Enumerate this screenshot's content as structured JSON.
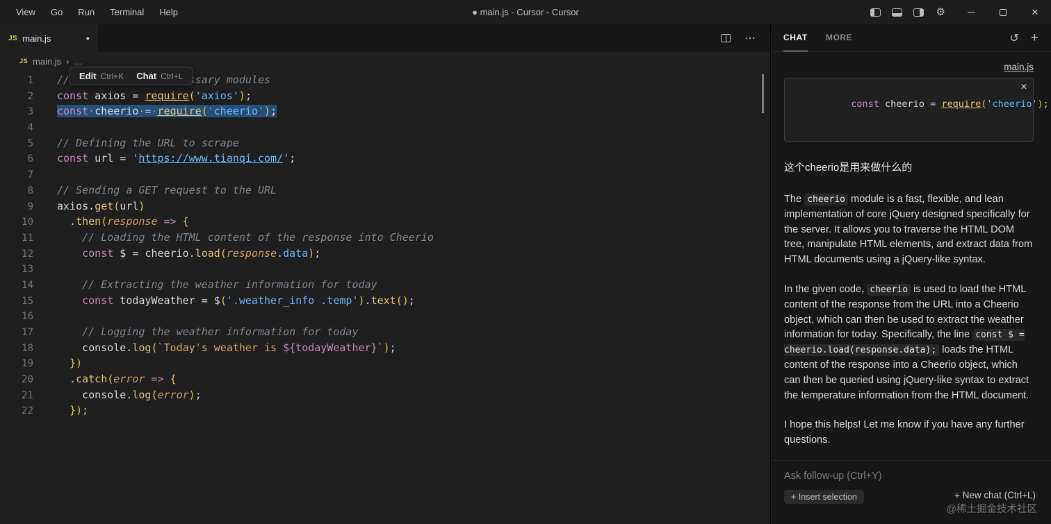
{
  "title_bar": {
    "menus": [
      "View",
      "Go",
      "Run",
      "Terminal",
      "Help"
    ],
    "window_title": "● main.js - Cursor - Cursor"
  },
  "icons": {
    "modified_dot": "●",
    "close": "✕",
    "more": "⋯",
    "history": "↺",
    "plus": "+",
    "gear": "⚙",
    "breadcrumb_separator": "›",
    "breadcrumb_more": "…"
  },
  "tab_bar": {
    "active_tab": {
      "icon": "JS",
      "label": "main.js"
    }
  },
  "breadcrumb": {
    "icon": "JS",
    "file": "main.js"
  },
  "tooltip": {
    "edit_label": "Edit",
    "edit_key": "Ctrl+K",
    "chat_label": "Chat",
    "chat_key": "Ctrl+L"
  },
  "colors": {
    "selection_blue": "#264f78",
    "js_yellow": "#e8d44e",
    "keyword_pink": "#c586c0",
    "string_blue": "#6cb6ff",
    "function_gold": "#e5c07b",
    "param_orange": "#d19a66",
    "comment_gray": "#7d8590"
  },
  "editor": {
    "lines": [
      {
        "n": "1",
        "tokens": [
          {
            "c": "cm",
            "t": "// Importing the necessary modules"
          }
        ]
      },
      {
        "n": "2",
        "tokens": [
          {
            "c": "kw",
            "t": "const"
          },
          {
            "c": "df",
            "t": " axios = "
          },
          {
            "c": "fnu",
            "t": "require"
          },
          {
            "c": "br",
            "t": "("
          },
          {
            "c": "str",
            "t": "'axios'"
          },
          {
            "c": "br",
            "t": ")"
          },
          {
            "c": "df",
            "t": ";"
          }
        ]
      },
      {
        "n": "3",
        "sel": true,
        "tokens": [
          {
            "c": "kw",
            "t": "const"
          },
          {
            "c": "ws",
            "t": "·"
          },
          {
            "c": "df",
            "t": "cheerio"
          },
          {
            "c": "ws",
            "t": "·"
          },
          {
            "c": "df",
            "t": "="
          },
          {
            "c": "ws",
            "t": "·"
          },
          {
            "c": "fnu",
            "t": "require"
          },
          {
            "c": "br",
            "t": "("
          },
          {
            "c": "str",
            "t": "'cheerio'"
          },
          {
            "c": "br",
            "t": ")"
          },
          {
            "c": "df",
            "t": ";"
          }
        ]
      },
      {
        "n": "4",
        "tokens": []
      },
      {
        "n": "5",
        "tokens": [
          {
            "c": "cm",
            "t": "// Defining the URL to scrape"
          }
        ]
      },
      {
        "n": "6",
        "tokens": [
          {
            "c": "kw",
            "t": "const"
          },
          {
            "c": "df",
            "t": " url = "
          },
          {
            "c": "str",
            "t": "'"
          },
          {
            "c": "stru",
            "t": "https://www.tianqi.com/"
          },
          {
            "c": "str",
            "t": "'"
          },
          {
            "c": "df",
            "t": ";"
          }
        ]
      },
      {
        "n": "7",
        "tokens": []
      },
      {
        "n": "8",
        "tokens": [
          {
            "c": "cm",
            "t": "// Sending a GET request to the URL"
          }
        ]
      },
      {
        "n": "9",
        "tokens": [
          {
            "c": "df",
            "t": "axios."
          },
          {
            "c": "fn",
            "t": "get"
          },
          {
            "c": "br",
            "t": "("
          },
          {
            "c": "df",
            "t": "url"
          },
          {
            "c": "br",
            "t": ")"
          }
        ]
      },
      {
        "n": "10",
        "tokens": [
          {
            "c": "df",
            "t": "  ."
          },
          {
            "c": "fn",
            "t": "then"
          },
          {
            "c": "br",
            "t": "("
          },
          {
            "c": "pr",
            "t": "response"
          },
          {
            "c": "df",
            "t": " "
          },
          {
            "c": "kw",
            "t": "=>"
          },
          {
            "c": "df",
            "t": " "
          },
          {
            "c": "br",
            "t": "{"
          }
        ]
      },
      {
        "n": "11",
        "tokens": [
          {
            "c": "df",
            "t": "    "
          },
          {
            "c": "cm",
            "t": "// Loading the HTML content of the response into Cheerio"
          }
        ]
      },
      {
        "n": "12",
        "tokens": [
          {
            "c": "df",
            "t": "    "
          },
          {
            "c": "kw",
            "t": "const"
          },
          {
            "c": "df",
            "t": " $ = cheerio."
          },
          {
            "c": "fn",
            "t": "load"
          },
          {
            "c": "br",
            "t": "("
          },
          {
            "c": "pr",
            "t": "response"
          },
          {
            "c": "df",
            "t": "."
          },
          {
            "c": "prop",
            "t": "data"
          },
          {
            "c": "br",
            "t": ")"
          },
          {
            "c": "df",
            "t": ";"
          }
        ]
      },
      {
        "n": "13",
        "tokens": []
      },
      {
        "n": "14",
        "tokens": [
          {
            "c": "df",
            "t": "    "
          },
          {
            "c": "cm",
            "t": "// Extracting the weather information for today"
          }
        ]
      },
      {
        "n": "15",
        "tokens": [
          {
            "c": "df",
            "t": "    "
          },
          {
            "c": "kw",
            "t": "const"
          },
          {
            "c": "df",
            "t": " todayWeather = $"
          },
          {
            "c": "br",
            "t": "("
          },
          {
            "c": "str",
            "t": "'.weather_info .temp'"
          },
          {
            "c": "br",
            "t": ")"
          },
          {
            "c": "df",
            "t": "."
          },
          {
            "c": "fn",
            "t": "text"
          },
          {
            "c": "br",
            "t": "()"
          },
          {
            "c": "df",
            "t": ";"
          }
        ]
      },
      {
        "n": "16",
        "tokens": []
      },
      {
        "n": "17",
        "tokens": [
          {
            "c": "df",
            "t": "    "
          },
          {
            "c": "cm",
            "t": "// Logging the weather information for today"
          }
        ]
      },
      {
        "n": "18",
        "tokens": [
          {
            "c": "df",
            "t": "    console."
          },
          {
            "c": "fn",
            "t": "log"
          },
          {
            "c": "br",
            "t": "("
          },
          {
            "c": "tpl",
            "t": "`Today's weather is "
          },
          {
            "c": "te",
            "t": "${todayWeather}"
          },
          {
            "c": "tpl",
            "t": "`"
          },
          {
            "c": "br",
            "t": ")"
          },
          {
            "c": "df",
            "t": ";"
          }
        ]
      },
      {
        "n": "19",
        "tokens": [
          {
            "c": "df",
            "t": "  "
          },
          {
            "c": "br",
            "t": "})"
          }
        ]
      },
      {
        "n": "20",
        "tokens": [
          {
            "c": "df",
            "t": "  ."
          },
          {
            "c": "fn",
            "t": "catch"
          },
          {
            "c": "br",
            "t": "("
          },
          {
            "c": "pr",
            "t": "error"
          },
          {
            "c": "df",
            "t": " "
          },
          {
            "c": "kw",
            "t": "=>"
          },
          {
            "c": "df",
            "t": " "
          },
          {
            "c": "br",
            "t": "{"
          }
        ]
      },
      {
        "n": "21",
        "tokens": [
          {
            "c": "df",
            "t": "    console."
          },
          {
            "c": "fn",
            "t": "log"
          },
          {
            "c": "br",
            "t": "("
          },
          {
            "c": "pr",
            "t": "error"
          },
          {
            "c": "br",
            "t": ")"
          },
          {
            "c": "df",
            "t": ";"
          }
        ]
      },
      {
        "n": "22",
        "tokens": [
          {
            "c": "df",
            "t": "  "
          },
          {
            "c": "br",
            "t": "});"
          }
        ]
      }
    ]
  },
  "chat": {
    "tab_chat": "CHAT",
    "tab_more": "MORE",
    "file_ref": "main.js",
    "snippet_tokens": [
      {
        "c": "kw",
        "t": "const"
      },
      {
        "c": "df",
        "t": " cheerio = "
      },
      {
        "c": "fnu",
        "t": "require"
      },
      {
        "c": "br",
        "t": "("
      },
      {
        "c": "str",
        "t": "'cheerio'"
      },
      {
        "c": "br",
        "t": ")"
      },
      {
        "c": "df",
        "t": ";"
      }
    ],
    "user_message": "这个cheerio是用来做什么的",
    "answer_paragraphs": [
      [
        {
          "t": "The "
        },
        {
          "t": "cheerio",
          "code": true
        },
        {
          "t": " module is a fast, flexible, and lean implementation of core jQuery designed specifically for the server. It allows you to traverse the HTML DOM tree, manipulate HTML elements, and extract data from HTML documents using a jQuery-like syntax."
        }
      ],
      [
        {
          "t": "In the given code, "
        },
        {
          "t": "cheerio",
          "code": true
        },
        {
          "t": " is used to load the HTML content of the response from the URL into a Cheerio object, which can then be used to extract the weather information for today. Specifically, the line "
        },
        {
          "t": "const $ = cheerio.load(response.data);",
          "code": true
        },
        {
          "t": " loads the HTML content of the response into a Cheerio object, which can then be queried using jQuery-like syntax to extract the temperature information from the HTML document."
        }
      ],
      [
        {
          "t": "I hope this helps! Let me know if you have any further questions."
        }
      ]
    ],
    "followup_placeholder": "Ask follow-up (Ctrl+Y)",
    "insert_selection_label": "+ Insert selection",
    "new_chat_label": "+ New chat (Ctrl+L)",
    "watermark": "@稀土掘金技术社区"
  }
}
